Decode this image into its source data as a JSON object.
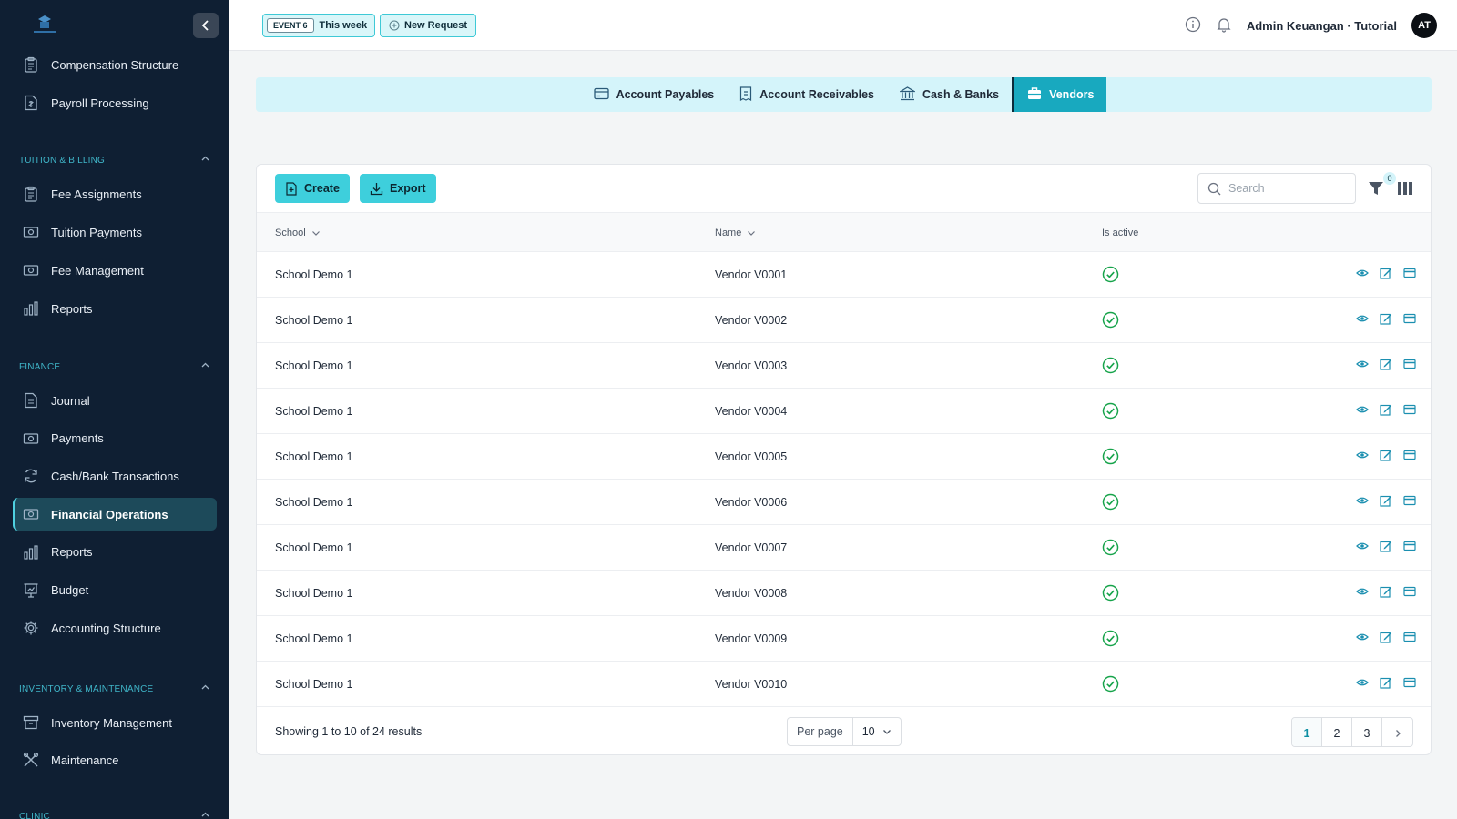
{
  "header": {
    "event_tag": "EVENT 6",
    "event_label": "This week",
    "new_request": "New Request",
    "user_name": "Admin Keuangan · Tutorial",
    "avatar_initials": "AT"
  },
  "sidebar": {
    "items_top": [
      {
        "label": "Compensation Structure",
        "icon": "clipboard-icon"
      },
      {
        "label": "Payroll Processing",
        "icon": "payroll-doc-icon"
      }
    ],
    "sections": [
      {
        "title": "TUITION & BILLING"
      },
      {
        "title": "FINANCE"
      },
      {
        "title": "INVENTORY & MAINTENANCE"
      },
      {
        "title": "CLINIC"
      }
    ],
    "tuition_items": [
      {
        "label": "Fee Assignments",
        "icon": "clipboard-icon"
      },
      {
        "label": "Tuition Payments",
        "icon": "cash-icon"
      },
      {
        "label": "Fee Management",
        "icon": "cash-icon"
      },
      {
        "label": "Reports",
        "icon": "bar-chart-icon"
      }
    ],
    "finance_items": [
      {
        "label": "Journal",
        "icon": "document-icon"
      },
      {
        "label": "Payments",
        "icon": "cash-icon"
      },
      {
        "label": "Cash/Bank Transactions",
        "icon": "refresh-icon"
      },
      {
        "label": "Financial Operations",
        "icon": "cash-icon",
        "active": true
      },
      {
        "label": "Reports",
        "icon": "bar-chart-icon"
      },
      {
        "label": "Budget",
        "icon": "presentation-chart-icon"
      },
      {
        "label": "Accounting Structure",
        "icon": "gear-icon"
      }
    ],
    "inventory_items": [
      {
        "label": "Inventory Management",
        "icon": "archive-box-icon"
      },
      {
        "label": "Maintenance",
        "icon": "wrench-screwdriver-icon"
      }
    ]
  },
  "tabs": [
    {
      "label": "Account Payables",
      "icon": "credit-card-icon"
    },
    {
      "label": "Account Receivables",
      "icon": "receipt-icon"
    },
    {
      "label": "Cash & Banks",
      "icon": "bank-icon"
    },
    {
      "label": "Vendors",
      "icon": "briefcase-icon",
      "active": true
    }
  ],
  "toolbar": {
    "create_label": "Create",
    "export_label": "Export",
    "search_placeholder": "Search",
    "filter_count": "0"
  },
  "table": {
    "columns": [
      "School",
      "Name",
      "Is active"
    ],
    "rows": [
      {
        "school": "School Demo 1",
        "name": "Vendor V0001",
        "active": true
      },
      {
        "school": "School Demo 1",
        "name": "Vendor V0002",
        "active": true
      },
      {
        "school": "School Demo 1",
        "name": "Vendor V0003",
        "active": true
      },
      {
        "school": "School Demo 1",
        "name": "Vendor V0004",
        "active": true
      },
      {
        "school": "School Demo 1",
        "name": "Vendor V0005",
        "active": true
      },
      {
        "school": "School Demo 1",
        "name": "Vendor V0006",
        "active": true
      },
      {
        "school": "School Demo 1",
        "name": "Vendor V0007",
        "active": true
      },
      {
        "school": "School Demo 1",
        "name": "Vendor V0008",
        "active": true
      },
      {
        "school": "School Demo 1",
        "name": "Vendor V0009",
        "active": true
      },
      {
        "school": "School Demo 1",
        "name": "Vendor V0010",
        "active": true
      }
    ]
  },
  "footer": {
    "showing": "Showing 1 to 10 of 24 results",
    "per_page_label": "Per page",
    "per_page_value": "10",
    "pages": [
      "1",
      "2",
      "3"
    ],
    "current_page": "1"
  },
  "colors": {
    "sidebar_bg": "#0f1f33",
    "accent": "#3ecfdc",
    "active_tab": "#18a9bf",
    "check_green": "#16a34a",
    "action_blue": "#1b8fb0"
  }
}
